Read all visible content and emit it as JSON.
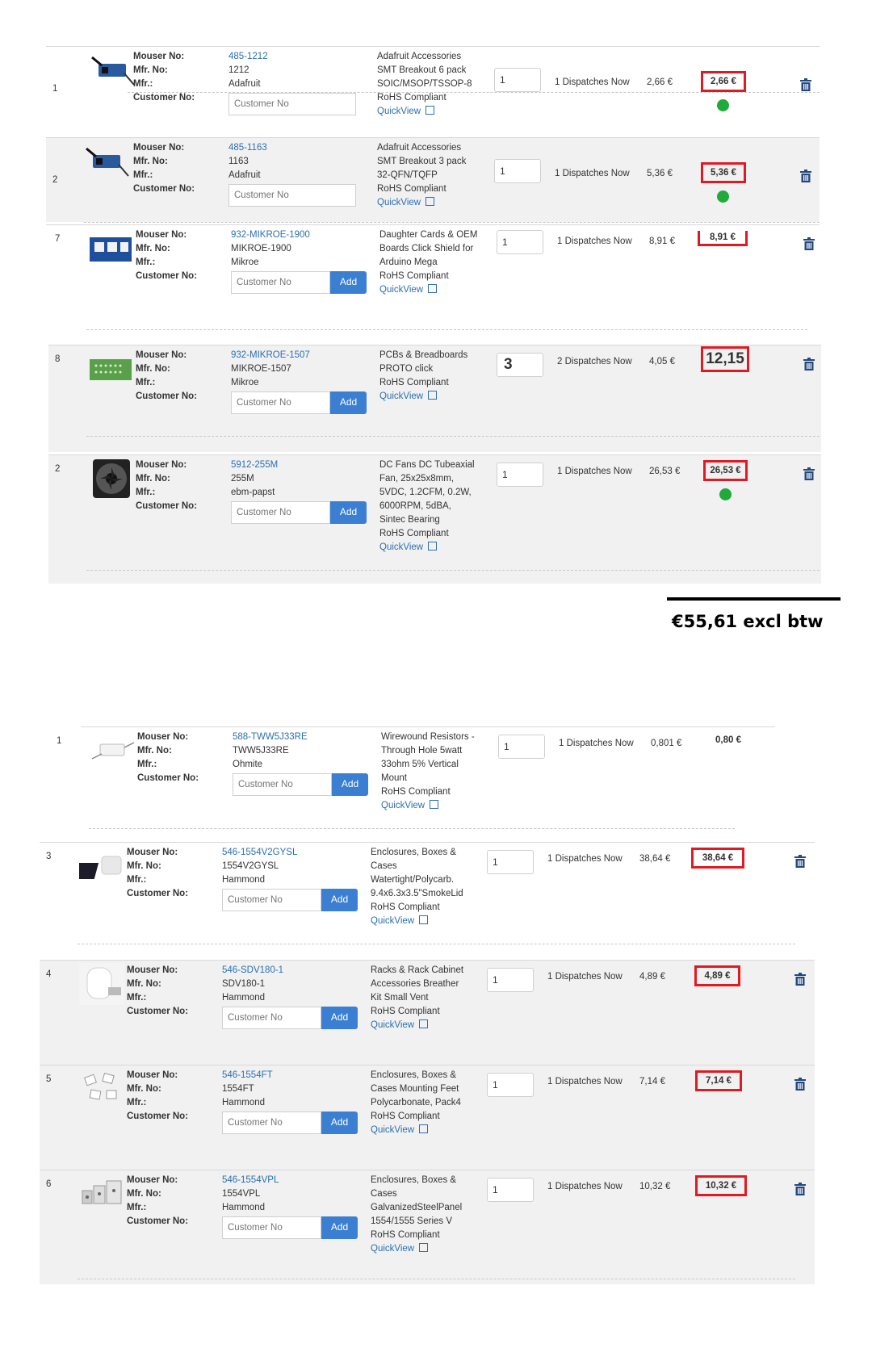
{
  "labels": {
    "mouser_no": "Mouser No:",
    "mfr_no": "Mfr. No:",
    "mfr": "Mfr.:",
    "customer_no": "Customer No:",
    "customer_placeholder": "Customer No",
    "add": "Add",
    "quickview": "QuickView",
    "dispatches": "Dispatches Now"
  },
  "total": "€55,61 excl btw",
  "rows": [
    {
      "index": "1",
      "mouser_no": "485-1212",
      "mfr_no": "1212",
      "mfr": "Adafruit",
      "desc": [
        "Adafruit Accessories",
        "SMT Breakout 6 pack",
        "SOIC/MSOP/TSSOP-8",
        "RoHS Compliant"
      ],
      "qty": "1",
      "avail_qty": "1",
      "unit": "2,66 €",
      "ext": "2,66 €",
      "has_add": false,
      "boxed": true,
      "dot": true,
      "thumb": "breakout-board-icon"
    },
    {
      "index": "2",
      "mouser_no": "485-1163",
      "mfr_no": "1163",
      "mfr": "Adafruit",
      "desc": [
        "Adafruit Accessories",
        "SMT Breakout 3 pack",
        "32-QFN/TQFP",
        "RoHS Compliant"
      ],
      "qty": "1",
      "avail_qty": "1",
      "unit": "5,36 €",
      "ext": "5,36 €",
      "has_add": false,
      "boxed": true,
      "dot": true,
      "thumb": "breakout-board-icon"
    },
    {
      "index": "7",
      "mouser_no": "932-MIKROE-1900",
      "mfr_no": "MIKROE-1900",
      "mfr": "Mikroe",
      "desc": [
        "Daughter Cards & OEM",
        "Boards Click Shield for",
        "Arduino Mega",
        "RoHS Compliant"
      ],
      "qty": "1",
      "avail_qty": "1",
      "unit": "8,91 €",
      "ext": "8,91 €",
      "has_add": true,
      "boxed": true,
      "dot": false,
      "thumb": "shield-board-icon"
    },
    {
      "index": "8",
      "mouser_no": "932-MIKROE-1507",
      "mfr_no": "MIKROE-1507",
      "mfr": "Mikroe",
      "desc": [
        "PCBs & Breadboards",
        "PROTO click",
        "RoHS Compliant"
      ],
      "qty": "3",
      "avail_qty": "2",
      "unit": "4,05 €",
      "ext": "12,15",
      "has_add": true,
      "boxed": true,
      "dot": false,
      "thumb": "proto-board-icon"
    },
    {
      "index": "2",
      "mouser_no": "5912-255M",
      "mfr_no": "255M",
      "mfr": "ebm-papst",
      "desc": [
        "DC Fans DC Tubeaxial",
        "Fan, 25x25x8mm,",
        "5VDC, 1.2CFM, 0.2W,",
        "6000RPM, 5dBA,",
        "Sintec Bearing",
        "RoHS Compliant"
      ],
      "qty": "1",
      "avail_qty": "1",
      "unit": "26,53 €",
      "ext": "26,53 €",
      "has_add": true,
      "boxed": true,
      "dot": true,
      "thumb": "fan-icon"
    },
    {
      "index": "1",
      "mouser_no": "588-TWW5J33RE",
      "mfr_no": "TWW5J33RE",
      "mfr": "Ohmite",
      "desc": [
        "Wirewound Resistors -",
        "Through Hole 5watt",
        "33ohm 5% Vertical",
        "Mount",
        "RoHS Compliant"
      ],
      "qty": "1",
      "avail_qty": "1",
      "unit": "0,801 €",
      "ext": "0,80 €",
      "has_add": true,
      "boxed": false,
      "dot": false,
      "thumb": "resistor-icon"
    },
    {
      "index": "3",
      "mouser_no": "546-1554V2GYSL",
      "mfr_no": "1554V2GYSL",
      "mfr": "Hammond",
      "desc": [
        "Enclosures, Boxes &",
        "Cases",
        "Watertight/Polycarb.",
        "9.4x6.3x3.5\"SmokeLid",
        "RoHS Compliant"
      ],
      "qty": "1",
      "avail_qty": "1",
      "unit": "38,64 €",
      "ext": "38,64 €",
      "has_add": true,
      "boxed": true,
      "dot": false,
      "thumb": "enclosure-icon"
    },
    {
      "index": "4",
      "mouser_no": "546-SDV180-1",
      "mfr_no": "SDV180-1",
      "mfr": "Hammond",
      "desc": [
        "Racks & Rack Cabinet",
        "Accessories Breather",
        "Kit Small Vent",
        "RoHS Compliant"
      ],
      "qty": "1",
      "avail_qty": "1",
      "unit": "4,89 €",
      "ext": "4,89 €",
      "has_add": true,
      "boxed": true,
      "dot": false,
      "thumb": "vent-icon"
    },
    {
      "index": "5",
      "mouser_no": "546-1554FT",
      "mfr_no": "1554FT",
      "mfr": "Hammond",
      "desc": [
        "Enclosures, Boxes &",
        "Cases Mounting Feet",
        "Polycarbonate, Pack4",
        "RoHS Compliant"
      ],
      "qty": "1",
      "avail_qty": "1",
      "unit": "7,14 €",
      "ext": "7,14 €",
      "has_add": true,
      "boxed": true,
      "dot": false,
      "thumb": "mounting-feet-icon"
    },
    {
      "index": "6",
      "mouser_no": "546-1554VPL",
      "mfr_no": "1554VPL",
      "mfr": "Hammond",
      "desc": [
        "Enclosures, Boxes &",
        "Cases",
        "GalvanizedSteelPanel",
        "1554/1555 Series V",
        "RoHS Compliant"
      ],
      "qty": "1",
      "avail_qty": "1",
      "unit": "10,32 €",
      "ext": "10,32 €",
      "has_add": true,
      "boxed": true,
      "dot": false,
      "thumb": "steel-panel-icon"
    }
  ]
}
